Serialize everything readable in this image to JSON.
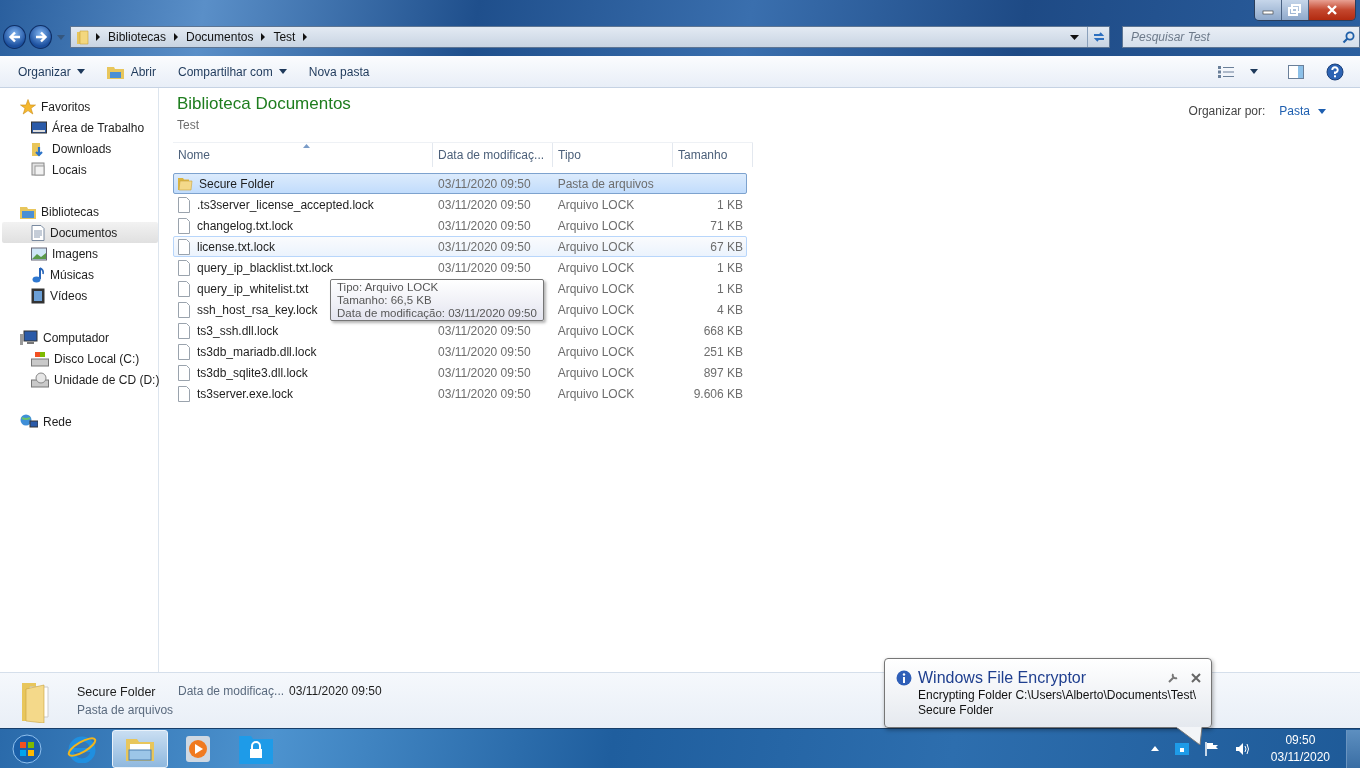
{
  "address_bar": {
    "crumbs": [
      "Bibliotecas",
      "Documentos",
      "Test"
    ]
  },
  "search": {
    "placeholder": "Pesquisar Test"
  },
  "toolbar": {
    "buttons": [
      {
        "label": "Organizar",
        "kind": "menu"
      },
      {
        "label": "Abrir",
        "kind": "open"
      },
      {
        "label": "Compartilhar com",
        "kind": "menu"
      },
      {
        "label": "Nova pasta",
        "kind": "plain"
      }
    ]
  },
  "sidebar": {
    "groups": [
      {
        "label": "Favoritos",
        "kind": "star",
        "children": [
          {
            "label": "Área de Trabalho",
            "kind": "desktop",
            "selected": false
          },
          {
            "label": "Downloads",
            "kind": "downloads",
            "selected": false
          },
          {
            "label": "Locais",
            "kind": "places",
            "selected": false
          }
        ]
      },
      {
        "label": "Bibliotecas",
        "kind": "library",
        "children": [
          {
            "label": "Documentos",
            "kind": "document",
            "selected": true
          },
          {
            "label": "Imagens",
            "kind": "picture",
            "selected": false
          },
          {
            "label": "Músicas",
            "kind": "music",
            "selected": false
          },
          {
            "label": "Vídeos",
            "kind": "video",
            "selected": false
          }
        ]
      },
      {
        "label": "Computador",
        "kind": "computer",
        "children": [
          {
            "label": "Disco Local (C:)",
            "kind": "disk",
            "selected": false
          },
          {
            "label": "Unidade de CD (D:)",
            "kind": "cd",
            "selected": false
          }
        ]
      },
      {
        "label": "Rede",
        "kind": "network"
      }
    ]
  },
  "header": {
    "title": "Biblioteca Documentos",
    "subtitle": "Test",
    "arrange_label": "Organizar por:",
    "arrange_value": "Pasta"
  },
  "table": {
    "columns": [
      {
        "label": "Nome",
        "sorted": true
      },
      {
        "label": "Data de modificaç...",
        "sorted": false
      },
      {
        "label": "Tipo",
        "sorted": false
      },
      {
        "label": "Tamanho",
        "sorted": false
      }
    ],
    "rows": [
      {
        "kind": "folder",
        "name": "Secure Folder",
        "date": "03/11/2020 09:50",
        "type": "Pasta de arquivos",
        "selected": true,
        "hovered": false
      },
      {
        "kind": "file",
        "name": ".ts3server_license_accepted.lock",
        "date": "03/11/2020 09:50",
        "type": "Arquivo LOCK",
        "size": "1 KB",
        "selected": false,
        "hovered": false
      },
      {
        "kind": "file",
        "name": "changelog.txt.lock",
        "date": "03/11/2020 09:50",
        "type": "Arquivo LOCK",
        "size": "71 KB",
        "selected": false,
        "hovered": false
      },
      {
        "kind": "file",
        "name": "license.txt.lock",
        "date": "03/11/2020 09:50",
        "type": "Arquivo LOCK",
        "size": "67 KB",
        "selected": false,
        "hovered": true
      },
      {
        "kind": "file",
        "name": "query_ip_blacklist.txt.lock",
        "date": "03/11/2020 09:50",
        "type": "Arquivo LOCK",
        "size": "1 KB",
        "selected": false,
        "hovered": false
      },
      {
        "kind": "file",
        "name": "query_ip_whitelist.txt",
        "type": "Arquivo LOCK",
        "size": "1 KB",
        "selected": false,
        "hovered": false
      },
      {
        "kind": "file",
        "name": "ssh_host_rsa_key.lock",
        "type": "Arquivo LOCK",
        "size": "4 KB",
        "selected": false,
        "hovered": false
      },
      {
        "kind": "file",
        "name": "ts3_ssh.dll.lock",
        "date": "03/11/2020 09:50",
        "type": "Arquivo LOCK",
        "size": "668 KB",
        "selected": false,
        "hovered": false
      },
      {
        "kind": "file",
        "name": "ts3db_mariadb.dll.lock",
        "date": "03/11/2020 09:50",
        "type": "Arquivo LOCK",
        "size": "251 KB",
        "selected": false,
        "hovered": false
      },
      {
        "kind": "file",
        "name": "ts3db_sqlite3.dll.lock",
        "date": "03/11/2020 09:50",
        "type": "Arquivo LOCK",
        "size": "897 KB",
        "selected": false,
        "hovered": false
      },
      {
        "kind": "file",
        "name": "ts3server.exe.lock",
        "date": "03/11/2020 09:50",
        "type": "Arquivo LOCK",
        "size": "9.606 KB",
        "selected": false,
        "hovered": false
      }
    ]
  },
  "tooltip": {
    "lines": [
      "Tipo: Arquivo LOCK",
      "Tamanho: 66,5 KB",
      "Data de modificação: 03/11/2020 09:50"
    ]
  },
  "details": {
    "name": "Secure Folder",
    "type": "Pasta de arquivos",
    "date_label": "Data de modificaç...",
    "date": "03/11/2020 09:50"
  },
  "notification": {
    "title": "Windows File Encryptor",
    "lines": [
      "Encrypting Folder C:\\Users\\Alberto\\Documents\\Test\\",
      "Secure Folder"
    ]
  },
  "taskbar": {
    "apps": [
      {
        "kind": "ie",
        "active": false
      },
      {
        "kind": "explorer",
        "active": true
      },
      {
        "kind": "media",
        "active": false
      },
      {
        "kind": "lockfolder",
        "active": false
      }
    ]
  },
  "clock": {
    "time": "09:50",
    "date": "03/11/2020"
  }
}
